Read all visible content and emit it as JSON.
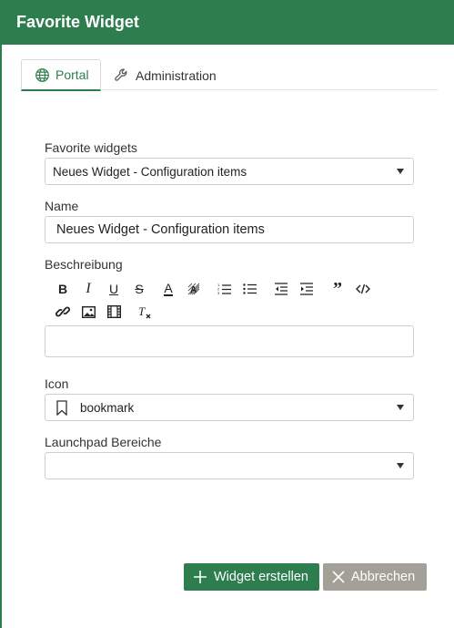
{
  "dialog": {
    "title": "Favorite Widget"
  },
  "tabs": [
    {
      "label": "Portal",
      "icon": "globe-icon",
      "active": true
    },
    {
      "label": "Administration",
      "icon": "wrench-icon",
      "active": false
    }
  ],
  "form": {
    "favorite_widgets": {
      "label": "Favorite widgets",
      "value": "Neues Widget - Configuration items"
    },
    "name": {
      "label": "Name",
      "value": "Neues Widget - Configuration items"
    },
    "description": {
      "label": "Beschreibung",
      "value": ""
    },
    "icon": {
      "label": "Icon",
      "value": "bookmark",
      "icon": "bookmark-icon"
    },
    "launchpad": {
      "label": "Launchpad Bereiche",
      "value": ""
    }
  },
  "toolbar": {
    "bold": "B",
    "italic": "I",
    "underline": "U",
    "strike": "S",
    "font_color": "A"
  },
  "buttons": {
    "create": "Widget erstellen",
    "cancel": "Abbrechen"
  },
  "colors": {
    "accent": "#2e7d4f",
    "secondary_button": "#a3a097"
  }
}
